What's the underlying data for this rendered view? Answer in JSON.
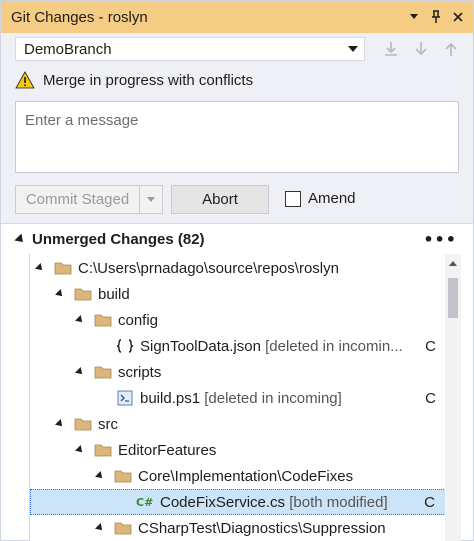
{
  "window": {
    "title": "Git Changes - roslyn"
  },
  "titlebar": {
    "icons": [
      "chevron-down-icon",
      "pin-icon",
      "close-icon"
    ]
  },
  "branch": {
    "selected": "DemoBranch"
  },
  "warning": {
    "text": "Merge in progress with conflicts"
  },
  "message": {
    "placeholder": "Enter a message"
  },
  "actions": {
    "commit_label": "Commit Staged",
    "abort_label": "Abort",
    "amend_label": "Amend"
  },
  "section": {
    "title": "Unmerged Changes (82)",
    "more": "•••"
  },
  "tree": [
    {
      "label": "C:\\Users\\prnadago\\source\\repos\\roslyn",
      "detail": "",
      "status": "",
      "type": "folder"
    },
    {
      "label": "build",
      "detail": "",
      "status": "",
      "type": "folder"
    },
    {
      "label": "config",
      "detail": "",
      "status": "",
      "type": "folder"
    },
    {
      "label": "SignToolData.json",
      "detail": "[deleted in incomin...",
      "status": "C",
      "type": "json"
    },
    {
      "label": "scripts",
      "detail": "",
      "status": "",
      "type": "folder"
    },
    {
      "label": "build.ps1",
      "detail": "[deleted in incoming]",
      "status": "C",
      "type": "ps1"
    },
    {
      "label": "src",
      "detail": "",
      "status": "",
      "type": "folder"
    },
    {
      "label": "EditorFeatures",
      "detail": "",
      "status": "",
      "type": "folder"
    },
    {
      "label": "Core\\Implementation\\CodeFixes",
      "detail": "",
      "status": "",
      "type": "folder"
    },
    {
      "label": "CodeFixService.cs",
      "detail": "[both modified]",
      "status": "C",
      "type": "cs"
    },
    {
      "label": "CSharpTest\\Diagnostics\\Suppression",
      "detail": "",
      "status": "",
      "type": "folder"
    }
  ]
}
